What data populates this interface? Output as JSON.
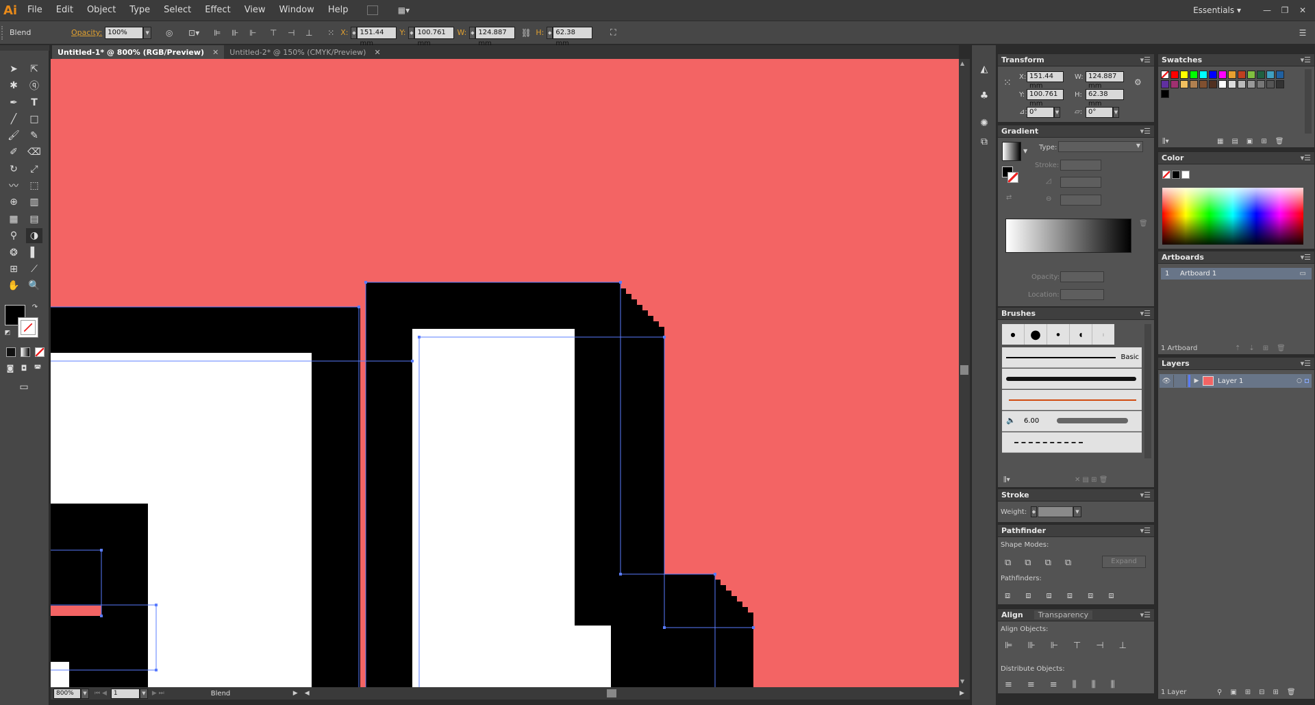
{
  "app": {
    "logo": "Ai",
    "workspace": "Essentials"
  },
  "menu": [
    "File",
    "Edit",
    "Object",
    "Type",
    "Select",
    "Effect",
    "View",
    "Window",
    "Help"
  ],
  "window_controls": {
    "minimize": "—",
    "restore": "❐",
    "close": "✕"
  },
  "control": {
    "selection": "Blend",
    "opacity_label": "Opacity:",
    "opacity_value": "100%",
    "x_label": "X:",
    "x_value": "151.44 mm",
    "y_label": "Y:",
    "y_value": "100.761 mm",
    "w_label": "W:",
    "w_value": "124.887 mm",
    "h_label": "H:",
    "h_value": "62.38 mm"
  },
  "tabs": [
    {
      "label": "Untitled-1* @ 800% (RGB/Preview)",
      "active": true
    },
    {
      "label": "Untitled-2* @ 150% (CMYK/Preview)",
      "active": false
    }
  ],
  "transform": {
    "title": "Transform",
    "x_label": "X:",
    "x": "151.44 mm",
    "y_label": "Y:",
    "y": "100.761 mm",
    "w_label": "W:",
    "w": "124.887 mm",
    "h_label": "H:",
    "h": "62.38 mm",
    "rotate": "0°",
    "shear": "0°"
  },
  "gradient": {
    "title": "Gradient",
    "type_label": "Type:",
    "stroke_label": "Stroke:",
    "opacity_label": "Opacity:",
    "location_label": "Location:"
  },
  "brushes": {
    "title": "Brushes",
    "basic_label": "Basic",
    "size_value": "6.00"
  },
  "stroke": {
    "title": "Stroke",
    "weight_label": "Weight:"
  },
  "pathfinder": {
    "title": "Pathfinder",
    "shape_modes_label": "Shape Modes:",
    "expand_label": "Expand",
    "pathfinders_label": "Pathfinders:"
  },
  "align": {
    "title": "Align",
    "tab2": "Transparency",
    "align_objects_label": "Align Objects:",
    "distribute_objects_label": "Distribute Objects:"
  },
  "swatches": {
    "title": "Swatches",
    "colors": [
      "#ff0000",
      "#ffff00",
      "#00ff00",
      "#00ffff",
      "#0000ff",
      "#ff00ff",
      "#e8a030",
      "#c04020",
      "#80c040",
      "#206040",
      "#40a0c0",
      "#2060a0",
      "#6030a0",
      "#a03070",
      "#f0c060",
      "#b08050",
      "#805030",
      "#503020",
      "#ffffff",
      "#dddddd",
      "#bbbbbb",
      "#999999",
      "#777777",
      "#555555",
      "#333333",
      "#000000"
    ]
  },
  "color": {
    "title": "Color"
  },
  "artboards": {
    "title": "Artboards",
    "items": [
      {
        "num": "1",
        "name": "Artboard 1"
      }
    ],
    "count": "1 Artboard"
  },
  "layers": {
    "title": "Layers",
    "items": [
      {
        "name": "Layer 1"
      }
    ],
    "count": "1 Layer"
  },
  "status": {
    "zoom": "800%",
    "page": "1",
    "tool": "Blend"
  },
  "colors": {
    "canvas": "#f36464",
    "selection": "#5a7cff",
    "accent": "#e88a1a"
  }
}
